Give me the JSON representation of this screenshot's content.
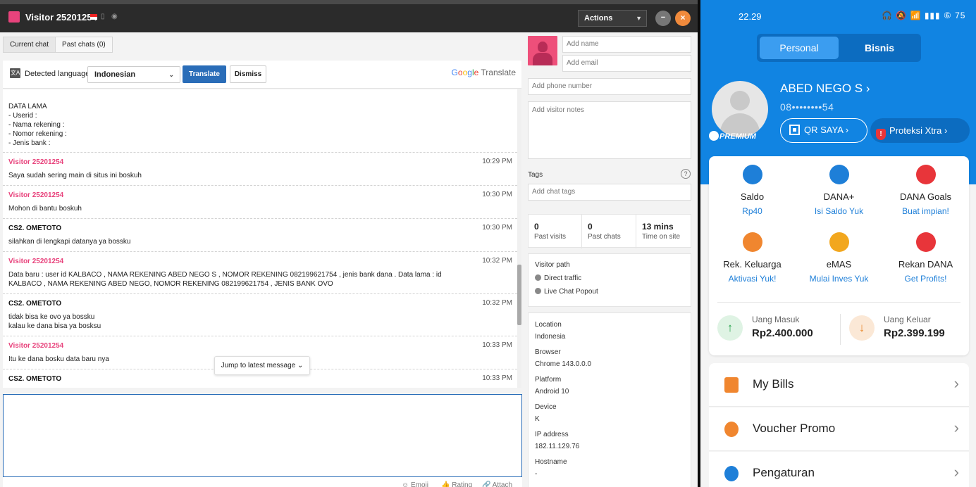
{
  "chat_window": {
    "title": "Visitor 25201254",
    "actions_label": "Actions",
    "minimize_label": "−",
    "close_label": "×",
    "tabs": [
      {
        "label": "Current chat"
      },
      {
        "label": "Past chats (0)"
      }
    ],
    "translate": {
      "icon_text": "文A",
      "detected_label": "Detected language",
      "language": "Indonesian",
      "translate_label": "Translate",
      "dismiss_label": "Dismiss",
      "brand": {
        "g": "G",
        "o1": "o",
        "o2": "o",
        "g2": "g",
        "l": "l",
        "e": "e",
        "word": "Translate"
      }
    },
    "data_lama": [
      "DATA LAMA",
      "- Userid :",
      "- Nama rekening :",
      "- Nomor rekening :",
      "- Jenis bank :"
    ],
    "messages": [
      {
        "sender": "Visitor 25201254",
        "type": "visitor",
        "time": "10:29 PM",
        "text": "Saya sudah sering main di situs ini boskuh"
      },
      {
        "sender": "Visitor 25201254",
        "type": "visitor",
        "time": "10:30 PM",
        "text": "Mohon di bantu boskuh"
      },
      {
        "sender": "CS2. OMETOTO",
        "type": "agent",
        "time": "10:30 PM",
        "text": "silahkan di lengkapi datanya ya bossku"
      },
      {
        "sender": "Visitor 25201254",
        "type": "visitor",
        "time": "10:32 PM",
        "text": "Data baru : user id KALBACO , NAMA REKENING ABED NEGO S , NOMOR REKENING 082199621754 , jenis bank dana . Data lama : id KALBACO , NAMA REKENING ABED NEGO, NOMOR REKENING 082199621754 , JENIS BANK OVO"
      },
      {
        "sender": "CS2. OMETOTO",
        "type": "agent",
        "time": "10:32 PM",
        "text": "tidak bisa ke ovo ya bossku\nkalau ke dana bisa ya bosksu"
      },
      {
        "sender": "Visitor 25201254",
        "type": "visitor",
        "time": "10:33 PM",
        "text": "Itu ke dana bosku data baru nya"
      },
      {
        "sender": "CS2. OMETOTO",
        "type": "agent",
        "time": "10:33 PM",
        "text": ""
      }
    ],
    "jump_latest": "Jump to latest message ⌄",
    "compose_tools": {
      "emoji": "☺ Emoji",
      "rating": "👍 Rating",
      "attach": "🔗 Attach"
    }
  },
  "visitor_panel": {
    "name_placeholder": "Add name",
    "email_placeholder": "Add email",
    "phone_placeholder": "Add phone number",
    "notes_placeholder": "Add visitor notes",
    "tags_label": "Tags",
    "tags_help": "?",
    "tags_placeholder": "Add chat tags",
    "stats": [
      {
        "num": "0",
        "label": "Past visits"
      },
      {
        "num": "0",
        "label": "Past chats"
      },
      {
        "num": "13 mins",
        "label": "Time on site"
      }
    ],
    "visitor_path_label": "Visitor path",
    "path": [
      "Direct traffic",
      "Live Chat Popout"
    ],
    "info": [
      {
        "label": "Location",
        "value": "Indonesia"
      },
      {
        "label": "Browser",
        "value": "Chrome 143.0.0.0"
      },
      {
        "label": "Platform",
        "value": "Android 10"
      },
      {
        "label": "Device",
        "value": "K"
      },
      {
        "label": "IP address",
        "value": "182.11.129.76"
      },
      {
        "label": "Hostname",
        "value": "-"
      }
    ]
  },
  "phone": {
    "status_time": "22.29",
    "status_icons": "🎧 🔕 📶 ▮▮▮ ⑥ 75",
    "segments": {
      "personal": "Personal",
      "bisnis": "Bisnis"
    },
    "premium": "PREMIUM",
    "user_name": "ABED NEGO S ›",
    "user_phone": "08••••••••54",
    "qr_label": "QR SAYA ›",
    "proteksi_label": "Proteksi Xtra ›",
    "proteksi_icon": "!",
    "services": [
      {
        "name": "Saldo",
        "sub": "Rp40",
        "icon": "wallet-icon",
        "color": "#1e7fd8"
      },
      {
        "name": "DANA+",
        "sub": "Isi Saldo Yuk",
        "icon": "plus-icon",
        "color": "#1e7fd8"
      },
      {
        "name": "DANA Goals",
        "sub": "Buat impian!",
        "icon": "target-icon",
        "color": "#e8353a"
      },
      {
        "name": "Rek. Keluarga",
        "sub": "Aktivasi Yuk!",
        "icon": "family-icon",
        "color": "#f0862f"
      },
      {
        "name": "eMAS",
        "sub": "Mulai Inves Yuk",
        "icon": "gold-icon",
        "color": "#f2a71e"
      },
      {
        "name": "Rekan DANA",
        "sub": "Get Profits!",
        "icon": "store-icon",
        "color": "#e8353a"
      }
    ],
    "cash_in": {
      "label": "Uang Masuk",
      "value": "Rp2.400.000",
      "arrow": "↑"
    },
    "cash_out": {
      "label": "Uang Keluar",
      "value": "Rp2.399.199",
      "arrow": "↓"
    },
    "menu": [
      {
        "label": "My Bills",
        "icon": "bill-icon",
        "color": "#f0862f"
      },
      {
        "label": "Voucher Promo",
        "icon": "voucher-icon",
        "color": "#f0862f"
      },
      {
        "label": "Pengaturan",
        "icon": "settings-icon",
        "color": "#1e7fd8"
      }
    ],
    "chevron": "›"
  }
}
